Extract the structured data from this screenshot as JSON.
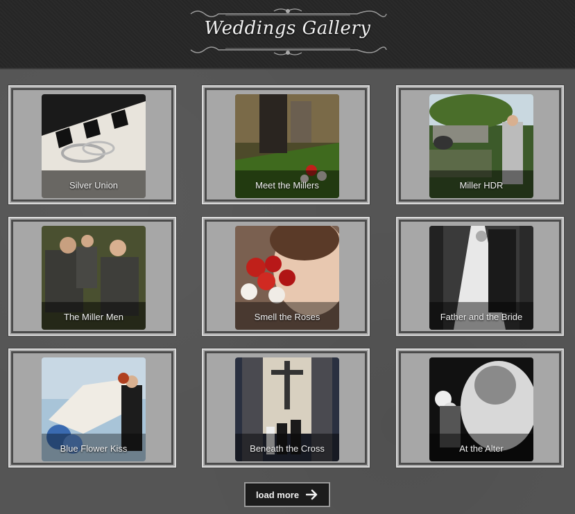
{
  "header": {
    "title": "Weddings Gallery"
  },
  "gallery": {
    "items": [
      {
        "caption": "Silver Union"
      },
      {
        "caption": "Meet the Millers"
      },
      {
        "caption": "Miller HDR"
      },
      {
        "caption": "The Miller Men"
      },
      {
        "caption": "Smell the Roses"
      },
      {
        "caption": "Father and the Bride"
      },
      {
        "caption": "Blue Flower Kiss"
      },
      {
        "caption": "Beneath the Cross"
      },
      {
        "caption": "At the Alter"
      }
    ]
  },
  "load_more": {
    "label": "load more",
    "icon": "arrow-right-icon"
  },
  "colors": {
    "header_bg": "#272727",
    "page_bg": "#555555",
    "card_bg": "#a7a7a7",
    "button_bg": "#1c1c1c"
  }
}
